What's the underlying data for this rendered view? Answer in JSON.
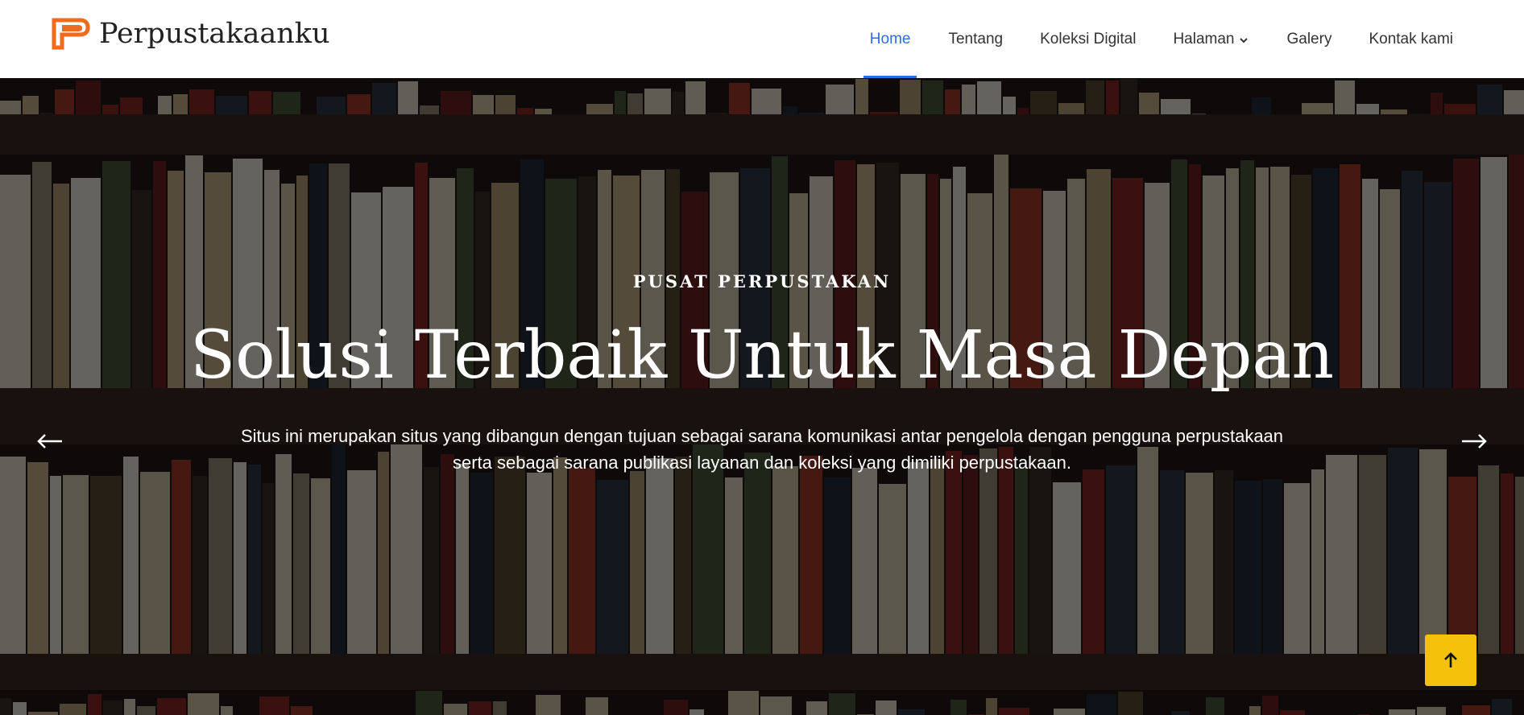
{
  "brand": {
    "name": "Perpustakaanku",
    "logo_icon": "brand-p-logo-icon",
    "logo_color": "#f26b1d"
  },
  "nav": {
    "items": [
      {
        "label": "Home",
        "active": true
      },
      {
        "label": "Tentang",
        "active": false
      },
      {
        "label": "Koleksi Digital",
        "active": false
      },
      {
        "label": "Halaman",
        "active": false,
        "has_dropdown": true,
        "dropdown_icon": "chevron-down-icon"
      },
      {
        "label": "Galery",
        "active": false
      },
      {
        "label": "Kontak kami",
        "active": false
      }
    ],
    "active_color": "#2d6ee0"
  },
  "hero": {
    "subtitle": "PUSAT PERPUSTAKAN",
    "title": "Solusi Terbaik Untuk Masa Depan",
    "description": "Situs ini merupakan situs yang dibangun dengan tujuan sebagai sarana komunikasi antar pengelola dengan pengguna perpustakaan serta sebagai sarana publikasi layanan dan koleksi yang dimiliki perpustakaan.",
    "prev_icon": "arrow-left-icon",
    "next_icon": "arrow-right-icon",
    "background": "bookshelf-photo"
  },
  "back_to_top": {
    "icon": "arrow-up-icon",
    "color": "#f5c10a"
  }
}
